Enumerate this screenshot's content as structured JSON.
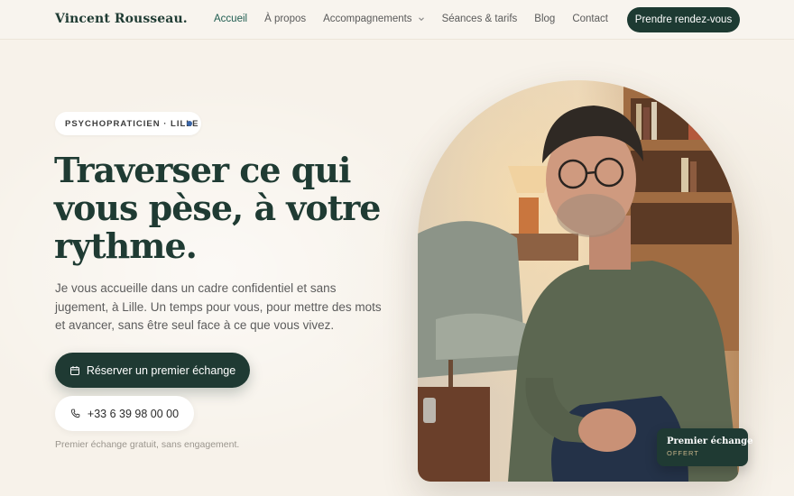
{
  "header": {
    "logo": "Vincent Rousseau.",
    "nav": [
      {
        "label": "Accueil",
        "active": true
      },
      {
        "label": "À propos"
      },
      {
        "label": "Accompagnements",
        "has_dropdown": true
      },
      {
        "label": "Séances & tarifs"
      },
      {
        "label": "Blog"
      },
      {
        "label": "Contact"
      }
    ],
    "cta_label": "Prendre rendez-vous"
  },
  "hero": {
    "badge": "PSYCHOPRATICIEN · LILLE",
    "headline_lines": [
      "Traverser ce qui",
      "vous pèse, à votre",
      "rythme."
    ],
    "lead": "Je vous accueille dans un cadre confidentiel et sans jugement, à Lille. Un temps pour vous, pour mettre des mots et avancer, sans être seul face à ce que vous vivez.",
    "primary_button": "Réserver un premier échange",
    "phone_button": "+33 6 39 98 00 00",
    "note": "Premier échange gratuit, sans engagement.",
    "offer_title": "Premier échange",
    "offer_sub": "OFFERT"
  },
  "colors": {
    "brand_dark": "#1d3a32",
    "accent_dot": "#3a66a8",
    "background": "#f7f2ea"
  },
  "icons": [
    "chevron-down-icon",
    "calendar-icon",
    "phone-icon"
  ]
}
